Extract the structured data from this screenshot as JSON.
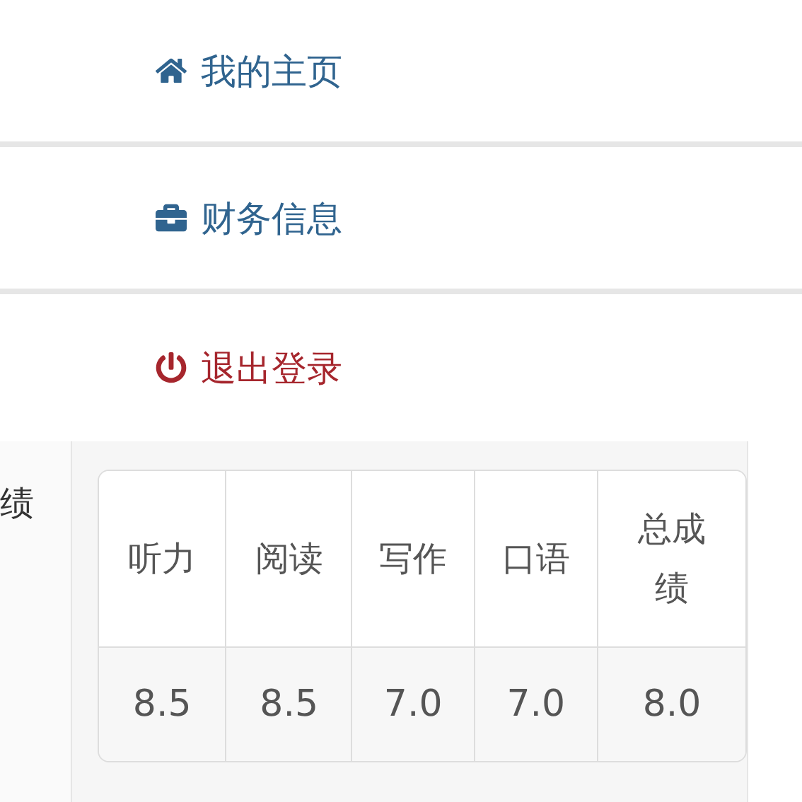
{
  "menu": [
    {
      "kind": "home",
      "label": "我的主页"
    },
    {
      "kind": "finance",
      "label": "财务信息"
    },
    {
      "kind": "logout",
      "label": "退出登录"
    }
  ],
  "side_label": "绩",
  "scores": {
    "columns": [
      "听力",
      "阅读",
      "写作",
      "口语",
      "总成绩"
    ],
    "values": [
      "8.5",
      "8.5",
      "7.0",
      "7.0",
      "8.0"
    ]
  }
}
